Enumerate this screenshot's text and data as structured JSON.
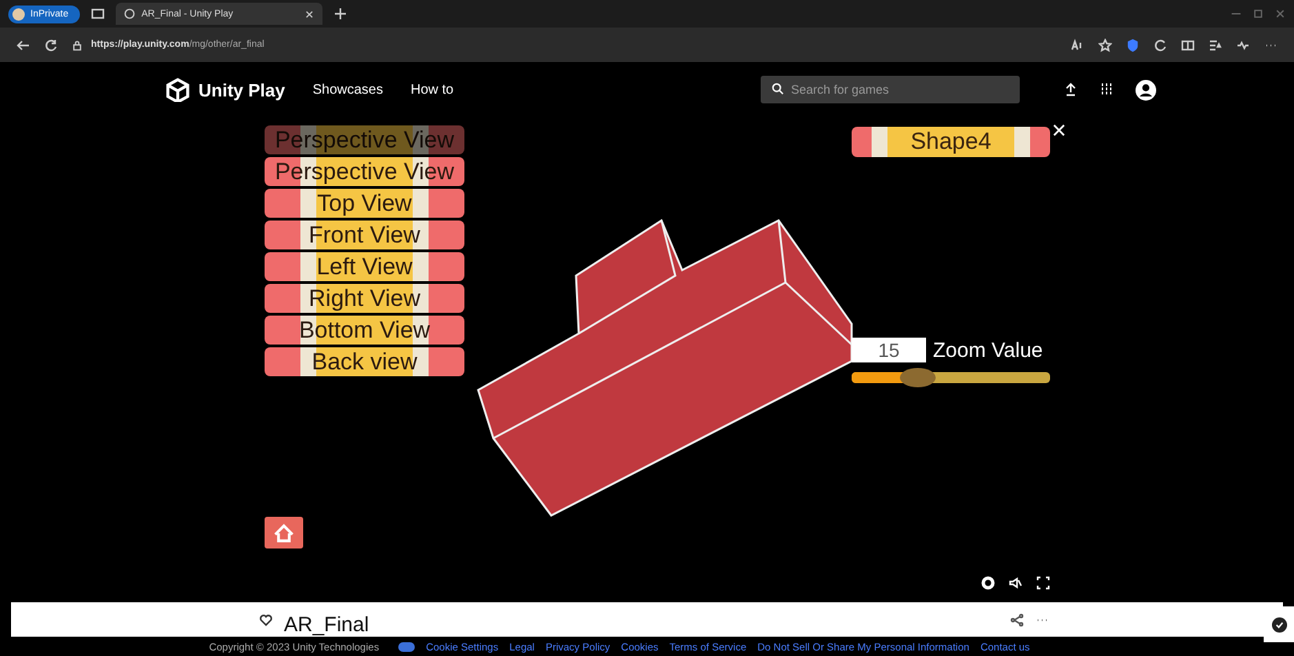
{
  "browser": {
    "profile": "InPrivate",
    "tab_title": "AR_Final - Unity Play",
    "url_host": "https://play.unity.com",
    "url_path": "/mg/other/ar_final"
  },
  "header": {
    "brand": "Unity Play",
    "nav": [
      "Showcases",
      "How to"
    ],
    "search": {
      "placeholder": "Search for games"
    }
  },
  "view_menu": [
    {
      "label": "Perspective View",
      "disabled": true
    },
    {
      "label": "Perspective View",
      "disabled": false
    },
    {
      "label": "Top View",
      "disabled": false
    },
    {
      "label": "Front View",
      "disabled": false
    },
    {
      "label": "Left View",
      "disabled": false
    },
    {
      "label": "Right View",
      "disabled": false
    },
    {
      "label": "Bottom View",
      "disabled": false
    },
    {
      "label": "Back view",
      "disabled": false
    }
  ],
  "shape_label": "Shape4",
  "zoom": {
    "value": "15",
    "label": "Zoom Value",
    "level": 0.33
  },
  "game": {
    "title": "AR_Final"
  },
  "footer": {
    "copyright": "Copyright © 2023 Unity Technologies",
    "links": [
      "Cookie Settings",
      "Legal",
      "Privacy Policy",
      "Cookies",
      "Terms of Service",
      "Do Not Sell Or Share My Personal Information",
      "Contact us"
    ]
  }
}
